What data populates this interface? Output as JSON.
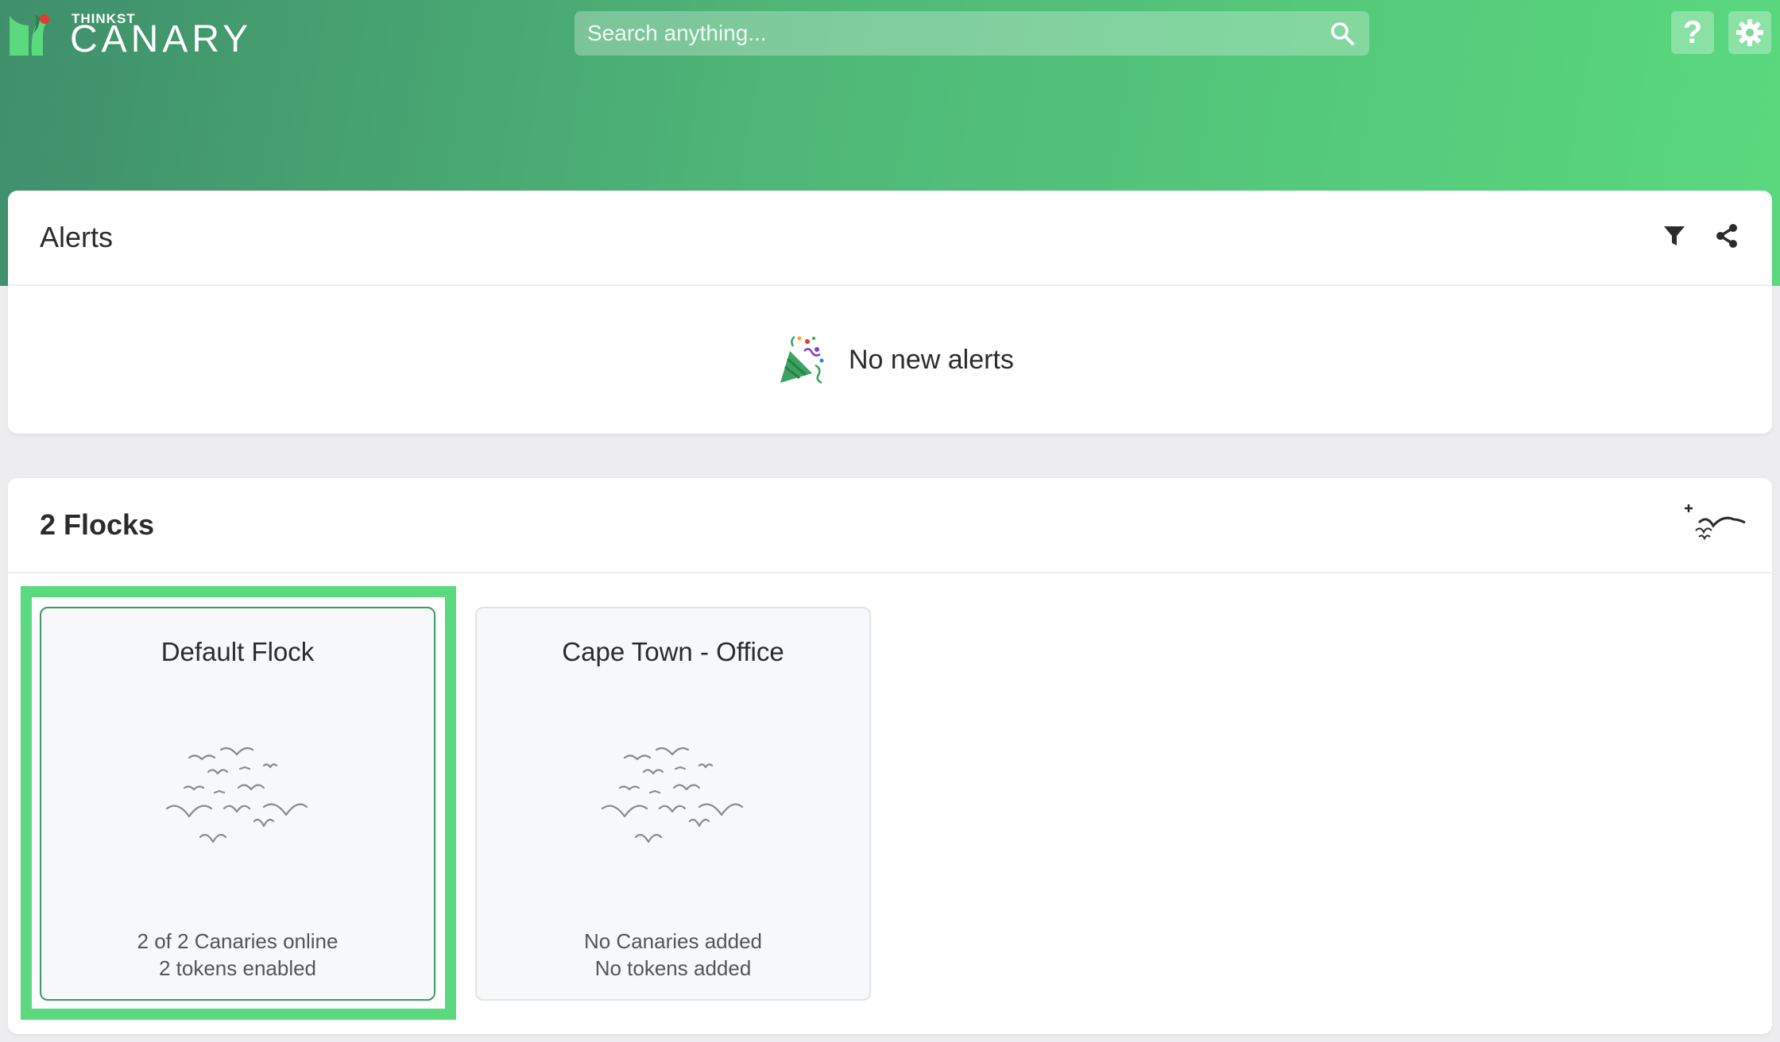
{
  "brand": {
    "top_line": "THINKST",
    "name": "CANARY"
  },
  "colors": {
    "accent": "#5ad97e",
    "header_start": "#3f8f6b",
    "header_end": "#5ad97e"
  },
  "search": {
    "placeholder": "Search anything..."
  },
  "header_buttons": {
    "help_label": "?"
  },
  "alerts": {
    "title": "Alerts",
    "empty_text": "No new alerts"
  },
  "flocks": {
    "title": "2 Flocks",
    "items": [
      {
        "name": "Default Flock",
        "line1": "2 of 2 Canaries online",
        "line2": "2 tokens enabled",
        "selected": true
      },
      {
        "name": "Cape Town - Office",
        "line1": "No Canaries added",
        "line2": "No tokens added",
        "selected": false
      }
    ]
  }
}
